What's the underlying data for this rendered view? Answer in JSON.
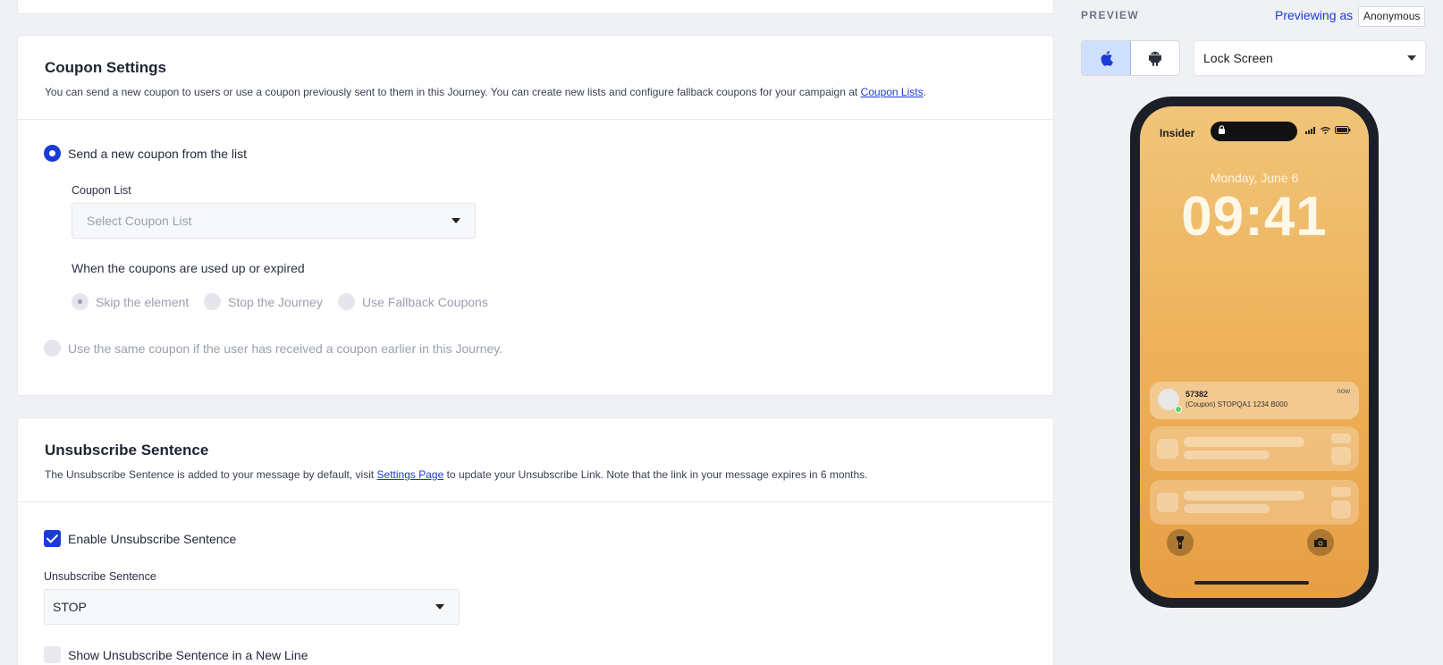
{
  "coupon_settings": {
    "title": "Coupon Settings",
    "desc_prefix": "You can send a new coupon to users or use a coupon previously sent to them in this Journey. You can create new lists and configure fallback coupons for your campaign at ",
    "desc_link": "Coupon Lists",
    "desc_suffix": ".",
    "option_new": "Send a new coupon from the list",
    "coupon_list_label": "Coupon List",
    "coupon_list_placeholder": "Select Coupon List",
    "used_up_question": "When the coupons are used up or expired",
    "used_up_options": [
      "Skip the element",
      "Stop the Journey",
      "Use Fallback Coupons"
    ],
    "option_same": "Use the same coupon if the user has received a coupon earlier in this Journey."
  },
  "unsubscribe": {
    "title": "Unsubscribe Sentence",
    "desc_prefix": "The Unsubscribe Sentence is added to your message by default, visit ",
    "desc_link": "Settings Page",
    "desc_suffix": " to update your Unsubscribe Link. Note that the link in your message expires in 6 months.",
    "enable_label": "Enable Unsubscribe Sentence",
    "sentence_label": "Unsubscribe Sentence",
    "sentence_value": "STOP",
    "new_line_label": "Show Unsubscribe Sentence in a New Line"
  },
  "preview": {
    "label": "PREVIEW",
    "previewing_as": "Previewing as",
    "user": "Anonymous",
    "screen_value": "Lock Screen",
    "phone": {
      "carrier": "Insider",
      "date": "Monday, June 6",
      "time": "09:41",
      "notif_title": "57382",
      "notif_body": "(Coupon) STOPQA1 1234 B000",
      "notif_time": "now"
    }
  },
  "colors": {
    "accent": "#1b3bd6",
    "lock_bg": "#eeb35c"
  }
}
